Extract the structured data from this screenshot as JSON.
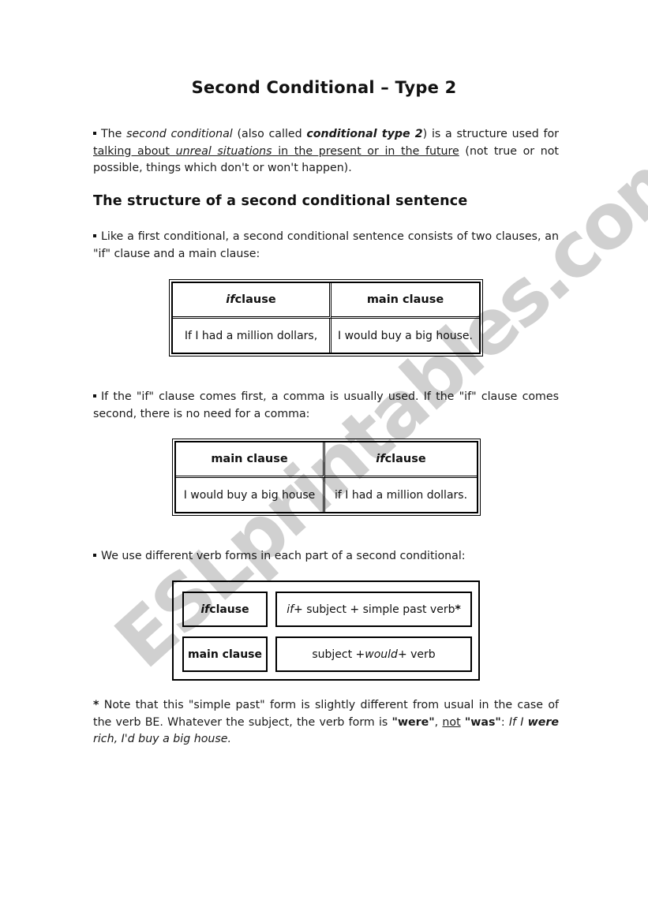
{
  "title": "Second Conditional – Type 2",
  "intro": {
    "p1": "The ",
    "p2_italic": "second conditional",
    "p3": " (also called ",
    "p4_bolditalic": "conditional type 2",
    "p5": ") is a structure used for ",
    "p6_underlined_a": "talking about ",
    "p7_underlined_italic": "unreal situations",
    "p8_underlined_b": " in the present or in the future",
    "p9": " (not true or not possible, things which don't or won't happen)."
  },
  "section_heading": "The structure of a second conditional sentence",
  "para2": "Like a first conditional, a second conditional sentence consists of two clauses, an \"if\" clause and a main clause:",
  "table1": {
    "headers": [
      {
        "italic": "if",
        "rest": " clause"
      },
      {
        "italic": "",
        "rest": "main clause"
      }
    ],
    "row": [
      "If I had a million dollars,",
      "I would buy a big house."
    ]
  },
  "para3": "If the \"if\" clause comes first, a comma is usually used. If the \"if\" clause comes second, there is no need for a comma:",
  "table2": {
    "headers": [
      {
        "italic": "",
        "rest": "main clause"
      },
      {
        "italic": "if",
        "rest": " clause"
      }
    ],
    "row": [
      "I would buy a big house",
      "if I had a million dollars."
    ]
  },
  "para4": "We use different verb forms in each part of a second conditional:",
  "table3": {
    "rows": [
      {
        "label_italic": "if",
        "label_rest": " clause",
        "formula_a_italic": "if",
        "formula_b": " + subject + simple past verb",
        "formula_c_bold": "*",
        "formula_d_italic": "",
        "formula_e": ""
      },
      {
        "label_italic": "",
        "label_rest": "main clause",
        "formula_a_italic": "",
        "formula_b": "subject + ",
        "formula_c_bold": "",
        "formula_d_italic": "would",
        "formula_e": " + verb"
      }
    ]
  },
  "note": {
    "star": "*",
    "t1": " Note that this \"simple past\" form is slightly different from usual in the case of the verb BE. Whatever the subject, the verb form is ",
    "were_bold": "\"were\"",
    "t2": ", ",
    "not_underlined": "not",
    "t3": " ",
    "was_bold": "\"was\"",
    "t4": ": ",
    "ex1_italic": "If I ",
    "ex2_bolditalic": "were",
    "ex3_italic": " rich, I'd buy a big house."
  },
  "watermark": "ESLprintables.com",
  "colors": {
    "text": "#111111",
    "watermark": "#c8c8c8",
    "border": "#000000"
  }
}
